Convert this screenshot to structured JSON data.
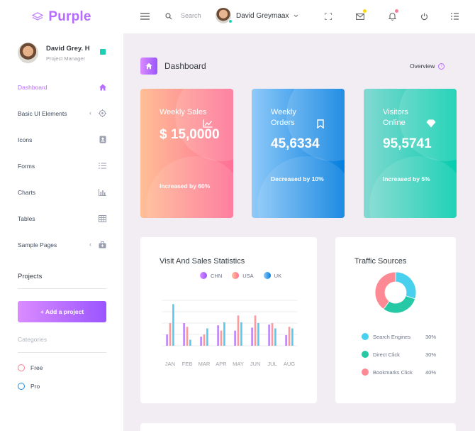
{
  "brand": {
    "name": "Purple",
    "color": "#b66dff"
  },
  "navbar": {
    "search_placeholder": "Search",
    "user_name": "David Greymaax",
    "icons": [
      "menu-icon",
      "search-icon",
      "fullscreen-icon",
      "mail-icon",
      "bell-icon",
      "power-icon",
      "list-icon"
    ]
  },
  "sidebar": {
    "profile_name": "David Grey. H",
    "profile_role": "Project Manager",
    "items": [
      {
        "label": "Dashboard",
        "icon": "home-icon",
        "active": true
      },
      {
        "label": "Basic UI Elements",
        "icon": "crosshair-icon",
        "caret": true
      },
      {
        "label": "Icons",
        "icon": "contacts-icon"
      },
      {
        "label": "Forms",
        "icon": "list-icon"
      },
      {
        "label": "Charts",
        "icon": "bar-chart-icon"
      },
      {
        "label": "Tables",
        "icon": "table-icon"
      },
      {
        "label": "Sample Pages",
        "icon": "medical-bag-icon",
        "caret": true
      }
    ],
    "projects_title": "Projects",
    "add_project_label": "+ Add a project",
    "categories_title": "Categories",
    "categories": [
      {
        "label": "Free",
        "color": "#fe7c96"
      },
      {
        "label": "Pro",
        "color": "#198ae3"
      }
    ]
  },
  "page": {
    "title": "Dashboard",
    "overview_label": "Overview"
  },
  "cards": [
    {
      "label": "Weekly Sales",
      "value": "$ 15,0000",
      "change": "Increased by 60%",
      "icon": "chart-line-icon",
      "gradient": [
        "#ffbf96",
        "#fe7096"
      ]
    },
    {
      "label": "Weekly Orders",
      "value": "45,6334",
      "change": "Decreased by 10%",
      "icon": "bookmark-icon",
      "gradient": [
        "#90caf9",
        "#047edf"
      ]
    },
    {
      "label": "Visitors Online",
      "value": "95,5741",
      "change": "Increased by 5%",
      "icon": "diamond-icon",
      "gradient": [
        "#84d9d2",
        "#07cdae"
      ]
    }
  ],
  "visit_stats": {
    "title": "Visit And Sales Statistics",
    "chart_data": {
      "type": "bar",
      "categories": [
        "JAN",
        "FEB",
        "MAR",
        "APR",
        "MAY",
        "JUN",
        "JUL",
        "AUG"
      ],
      "series": [
        {
          "name": "CHN",
          "color": "#c084fc",
          "values": [
            15,
            30,
            12,
            27,
            20,
            24,
            28,
            14
          ]
        },
        {
          "name": "USA",
          "color": "#fd9a9c",
          "values": [
            30,
            25,
            15,
            20,
            40,
            40,
            30,
            25
          ]
        },
        {
          "name": "UK",
          "color": "#5cc8ea",
          "values": [
            55,
            8,
            23,
            31,
            31,
            30,
            23,
            23
          ]
        }
      ],
      "ylim": [
        0,
        60
      ],
      "grid": true,
      "legend": "top-center"
    }
  },
  "traffic": {
    "title": "Traffic Sources",
    "chart_data": {
      "type": "pie",
      "categories": [
        "Search Engines",
        "Direct Click",
        "Bookmarks Click"
      ],
      "values": [
        30,
        30,
        40
      ],
      "display_values": [
        "30%",
        "30%",
        "40%"
      ],
      "colors": [
        "#48d0ee",
        "#25c9a5",
        "#fd8994"
      ],
      "legend": "bottom"
    }
  }
}
